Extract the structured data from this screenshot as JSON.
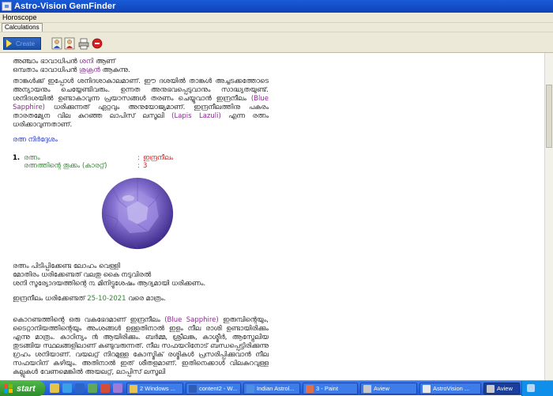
{
  "window": {
    "title": "Astro-Vision GemFinder"
  },
  "menu": {
    "items": [
      "Horoscope"
    ]
  },
  "tabs": [
    "Calculations"
  ],
  "toolbar": {
    "create_label": "Create"
  },
  "content": {
    "intro_line1_prefix": "അഞ്ചാം ഭാവാധിപൻ ",
    "intro_line1_planet": "ശനി",
    "intro_line1_suffix": " ആണ്",
    "intro_line2_prefix": "ഒമ്പതാം ഭാവാധിപൻ ",
    "intro_line2_planet": "ശുക്രൻ",
    "intro_line2_suffix": " ആകുന്നു.",
    "para2_text": "താങ്കൾക്ക് ഇപ്പോൾ ശനിദശാകാലമാണ്. ഈ ദശയിൽ താങ്കൾ അച്ചടക്കത്തോടെ അന്യായനും ചെയ്യേണ്ടിവരും. ഉന്നത അനുഭവപ്പെടുവാനും സാദ്ധ്യതയുണ്ട്. ശനിദശയിൽ ഉണ്ടാകാവുന്ന പ്രയാസങ്ങൾ തരണം ചെയ്യുവാൻ ഇന്ദ്രനീലം",
    "para2_gem_en": "(Blue Sapphire)",
    "para2_text2": " ധരിക്കുന്നത് ഏറ്റവും അനുയോജ്യമാണ്. ഇന്ദ്രനീലത്തിനു പകരം താരതമ്യേന വില കുറഞ്ഞ ലാപിസ് ലസൂലി",
    "para2_alt_en": "(Lapis Lazuli)",
    "para2_text3": " എന്ന രത്നം ധരിക്കാവുന്നതാണ്.",
    "section_heading": "രത്ന നിർദ്ദേശം",
    "item_number": "1.",
    "gem_label": "രത്നം",
    "gem_value": "ഇന്ദ്രനീലം",
    "weight_label": "രത്നത്തിന്റെ തൂക്കം (കാരറ്റ്)",
    "weight_value": "3",
    "colon": ":",
    "wear_line1": "രത്നം പിടിപ്പിക്കേണ്ട ലോഹം വെള്ളി",
    "wear_line2": "മോതിരം ധരിക്കേണ്ടത് വലതു കൈ നടുവിരൽ",
    "wear_line3": "ശനി സൂര്യോദയത്തിന്റെ ൩ മിനിട്ടുശേഷം ആദ്യമായി ധരിക്കണം.",
    "until_prefix": "ഇന്ദ്രനീലം ധരിക്കേണ്ടത് ",
    "until_date": "25-10-2021",
    "until_suffix": " വരെ മാത്രം.",
    "para5_text": "കൊറണ്ടത്തിന്റെ ഒരു വകഭേദമാണ് ഇന്ദ്രനീലം",
    "para5_gem_en": "(Blue Sapphire)",
    "para5_text2": " ഇരുമ്പിന്റെയും, ടൈറ്റാനിയത്തിന്റെയും അംശങ്ങൾ ഉള്ളതിനാൽ ഇളം നീല രാശി ഉണ്ടായിരിക്കും എന്നു മാത്രം. കാഠിന്യം ൯ ആയിരിക്കും. ബർമ്മ, ശ്രീലങ്ക, കാശ്മീർ, ആസ്ട്രേലിയ തുടങ്ങിയ സ്ഥലങ്ങളിലാണ് കണ്ടുവരുന്നത്. നീല സഫയറിനോട് ബന്ധപ്പെട്ടിരിക്കുന്നു ഗ്രഹം ശനിയാണ്. വയലറ്റ് നിറമുള്ള കോസ്മിക് രശ്മികൾ പ്രസരിപ്പിക്കുവാൻ നീല സഫയറിന് കഴിയും. അതിനാൽ ഇത് ശീതളമാണ്. ഇതിനെക്കാൾ വിലകുറവുള്ള കല്ലുകൾ വേണമെങ്കിൽ അയലറ്റ്, ലാപ്പിസ് ലസൂലി"
  },
  "taskbar": {
    "start_label": "start",
    "tasks": [
      {
        "label": "2 Windows ..."
      },
      {
        "label": "content2 - W..."
      },
      {
        "label": "Indian Astrol..."
      },
      {
        "label": "3 - Paint"
      },
      {
        "label": "Aview"
      },
      {
        "label": "AstroVision ..."
      },
      {
        "label": "Aview"
      }
    ]
  },
  "colors": {
    "titlebar": "#0f43b8",
    "planet_text": "#8a2b8f",
    "heading_text": "#2438c4",
    "gem_value": "#d01818",
    "label_green": "#2b8a2b",
    "gem_violet": "#7a63c9"
  }
}
